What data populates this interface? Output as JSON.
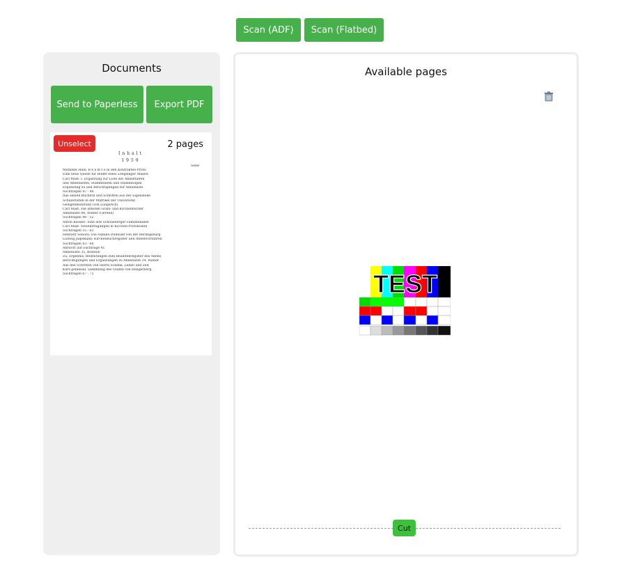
{
  "toolbar": {
    "scan_adf_label": "Scan (ADF)",
    "scan_flatbed_label": "Scan (Flatbed)"
  },
  "documents": {
    "title": "Documents",
    "send_label": "Send to Paperless",
    "export_label": "Export PDF",
    "selected": {
      "unselect_label": "Unselect",
      "page_count": "2 pages",
      "thumbnail": {
        "heading": "Inhalt",
        "year": "1959",
        "column_header": "Seite",
        "lines": [
          "Mathilde Hain: B e a m t e  in den Kontrakten-Proto-",
          "Eine neue Quelle für Bilder eines Lengsinger Malers",
          "Carl Mast: I. Ergänzung zur Liste der Ahnentafeln",
          "und Ahnenlisten, Stammtafeln und Stammfolgen",
          "Ergänzung zu und Berichtigungen zur Ahnenliste",
          "Suchfragen 47 - 48",
          "Aus seinen Büchern und Schriften aus der Eigenstelle",
          "Schulerlisten in der Matrikel der Universität",
          "Gelegenheitsfund (von Longerich)",
          "Carl Mast: Die ältesten Grafs- und Kirchenbücher",
          "Ahnenliste 84, Winter (Gerden)",
          "Suchfragen 49 - 52",
          "Anton Kessler: Eine alte Schöneberger Familienbibel",
          "Carl Mast: Neueintragungen in Kirchen-Protokollen",
          "Suchfragen 55 - 62",
          "Henriett Sonora: Die Familie Dudwald von der Berlingsburg",
          "Ludwig Jaqemann: Kirchenbuchregister und Ahnenvorfahren",
          "Suchfragen 63 - 66",
          "Antwort auf Suchfrage 41",
          "Ahnenliste 35, Brannin",
          "Zu, Ergebnis, Bedeutungen zum Beamtenregister des Amtes",
          "Berichtigungen und Ergänzungen zu Ahnenliste 34, Winter",
          "Aus den Schriften von Herrn Schenk, Leben und Zeit",
          "Kurs gemeisel, Sammlung des Grafen von Hengerberg",
          "Suchfragen 67 - 75"
        ]
      }
    }
  },
  "available": {
    "title": "Available pages",
    "cut_label": "Cut",
    "test_text": "TEST"
  },
  "icons": {
    "trash": "trash-icon"
  }
}
